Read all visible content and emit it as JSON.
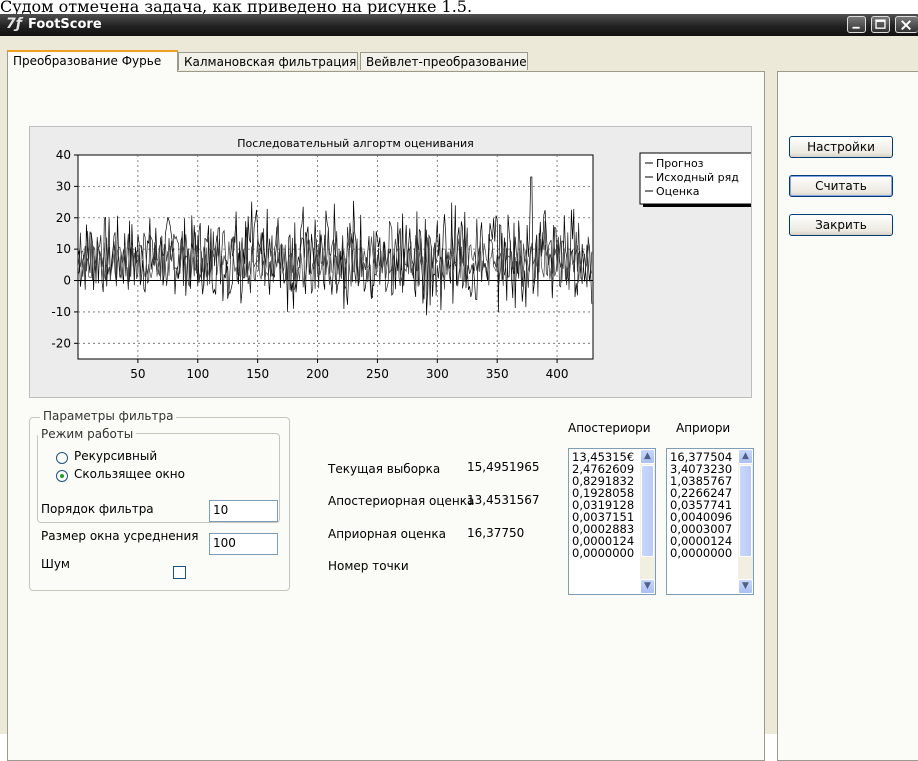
{
  "fragment_text": "Судом отмечена задача, как приведено на рисунке 1.5.",
  "window": {
    "icon": "footscore-icon",
    "title": "FootScore"
  },
  "tabs": [
    {
      "label": "Преобразование Фурье"
    },
    {
      "label": "Калмановская фильтрация"
    },
    {
      "label": "Вейвлет-преобразование"
    }
  ],
  "chart_data": {
    "type": "line",
    "title": "Последовательный алгортм оценивания",
    "xlim": [
      0,
      430
    ],
    "ylim": [
      -25,
      40
    ],
    "x_ticks": [
      50,
      100,
      150,
      200,
      250,
      300,
      350,
      400
    ],
    "y_ticks": [
      -20,
      -10,
      0,
      10,
      20,
      30,
      40
    ],
    "grid": true,
    "legend_position": "top-right",
    "series": [
      {
        "name": "Прогноз",
        "color": "#000000"
      },
      {
        "name": "Исходный ряд",
        "color": "#000000"
      },
      {
        "name": "Оценка",
        "color": "#000000"
      }
    ]
  },
  "filter_params": {
    "group_label": "Параметры фильтра",
    "mode_label": "Режим работы",
    "mode_options": [
      "Рекурсивный",
      "Скользящее окно"
    ],
    "mode_selected": 1,
    "order_label": "Порядок фильтра",
    "order_value": "10",
    "window_label": "Размер окна усреднения",
    "window_value": "100",
    "noise_label": "Шум",
    "noise_checked": false
  },
  "readouts": {
    "current_label": "Текущая выборка",
    "current_value": "15,4951965",
    "posterior_label": "Апостериорная оценка",
    "posterior_value": "13,4531567",
    "prior_label": "Априорная оценка",
    "prior_value": "16,37750",
    "point_label": "Номер точки"
  },
  "lists": {
    "posterior_header": "Апостериори",
    "prior_header": "Априори",
    "posterior_items": [
      "13,45315€",
      "2,4762609",
      "0,8291832",
      "0,1928058",
      "0,0319128",
      "0,0037151",
      "0,0002883",
      "0,0000124",
      "0,0000000"
    ],
    "prior_items": [
      "16,377504",
      "3,4073230",
      "1,0385767",
      "0,2266247",
      "0,0357741",
      "0,0040096",
      "0,0003007",
      "0,0000124",
      "0,0000000"
    ]
  },
  "buttons": {
    "settings": "Настройки",
    "calculate": "Считать",
    "close": "Закрить"
  }
}
